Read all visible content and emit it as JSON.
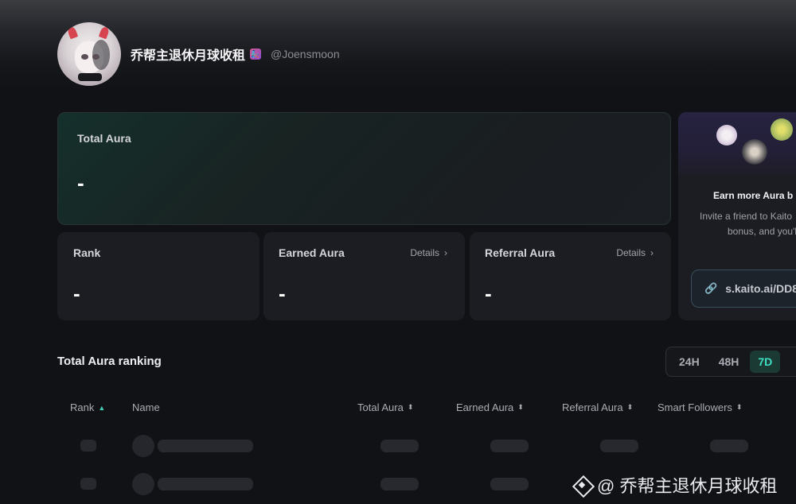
{
  "profile": {
    "name": "乔帮主退休月球收租",
    "badge": "🧞",
    "handle": "@Joensmoon"
  },
  "total_card": {
    "label": "Total Aura",
    "value": "-"
  },
  "rank_card": {
    "label": "Rank",
    "value": "-"
  },
  "earned_card": {
    "label": "Earned Aura",
    "details": "Details",
    "value": "-"
  },
  "referral_card": {
    "label": "Referral Aura",
    "details": "Details",
    "value": "-"
  },
  "invite": {
    "title": "Earn more Aura b",
    "desc_line1": "Invite a friend to Kaito",
    "desc_line2": "bonus, and you'll",
    "link": "s.kaito.ai/DD8"
  },
  "ranking": {
    "title": "Total Aura ranking",
    "tabs": [
      {
        "label": "24H",
        "active": false
      },
      {
        "label": "48H",
        "active": false
      },
      {
        "label": "7D",
        "active": true
      }
    ],
    "columns": [
      "Rank",
      "Name",
      "Total Aura",
      "Earned Aura",
      "Referral Aura",
      "Smart Followers"
    ]
  },
  "watermark": "@ 乔帮主退休月球收租",
  "colors": {
    "accent": "#3fe0c2",
    "background": "#111216",
    "card": "#1b1d22"
  }
}
